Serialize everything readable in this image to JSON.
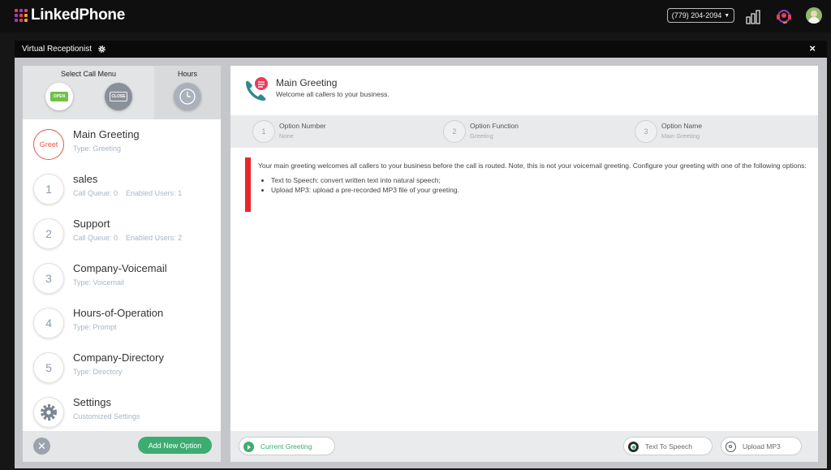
{
  "app": {
    "brand": "LinkedPhone",
    "phone_number": "(779) 204-2094",
    "brand_colors": [
      "#e93c5a",
      "#9b3fb8",
      "#e93c5a",
      "#9b3fb8",
      "#e93c5a",
      "#f0a030",
      "#9b3fb8",
      "#e93c5a",
      "#f0a030"
    ]
  },
  "header_icons": [
    "bar-chart-icon",
    "support-headset-icon",
    "user-avatar"
  ],
  "modal": {
    "title": "Virtual Receptionist",
    "close_label": "×"
  },
  "left_panel": {
    "select_call_menu_label": "Select Call Menu",
    "hours_label": "Hours",
    "open_sign_text": "OPEN",
    "close_sign_text": "CLOSE",
    "items": [
      {
        "badge": "Greet",
        "title": "Main Greeting",
        "sub1": "Type: Greeting",
        "sub2": ""
      },
      {
        "badge": "1",
        "title": "sales",
        "sub1": "Call Queue: 0",
        "sub2": "Enabled Users: 1"
      },
      {
        "badge": "2",
        "title": "Support",
        "sub1": "Call Queue: 0",
        "sub2": "Enabled Users: 2"
      },
      {
        "badge": "3",
        "title": "Company-Voicemail",
        "sub1": "Type: Voicemail",
        "sub2": ""
      },
      {
        "badge": "4",
        "title": "Hours-of-Operation",
        "sub1": "Type: Prompt",
        "sub2": ""
      },
      {
        "badge": "5",
        "title": "Company-Directory",
        "sub1": "Type: Directory",
        "sub2": ""
      },
      {
        "badge": "",
        "title": "Settings",
        "sub1": "Customized Settings",
        "sub2": ""
      }
    ],
    "add_button_label": "Add New Option"
  },
  "right_panel": {
    "title": "Main Greeting",
    "subtitle": "Welcome all callers to your business.",
    "steps": [
      {
        "num": "1",
        "label": "Option Number",
        "value": "None"
      },
      {
        "num": "2",
        "label": "Option Function",
        "value": "Greeting"
      },
      {
        "num": "3",
        "label": "Option Name",
        "value": "Main Greeting"
      }
    ],
    "info_text": "Your main greeting welcomes all callers to your business before the call is routed. Note, this is not your voicemail greeting. Configure your greeting with one of the following options:",
    "bullets": [
      "Text to Speech: convert written text into natural speech;",
      "Upload MP3: upload a pre-recorded MP3 file of your greeting."
    ],
    "current_greeting_label": "Current Greeting",
    "tts_label": "Text To Speech",
    "upload_label": "Upload MP3"
  },
  "colors": {
    "accent_green": "#3cad71",
    "alert_red": "#e8262a",
    "greet_red": "#e35b4b",
    "teal": "#2f8a8c"
  }
}
